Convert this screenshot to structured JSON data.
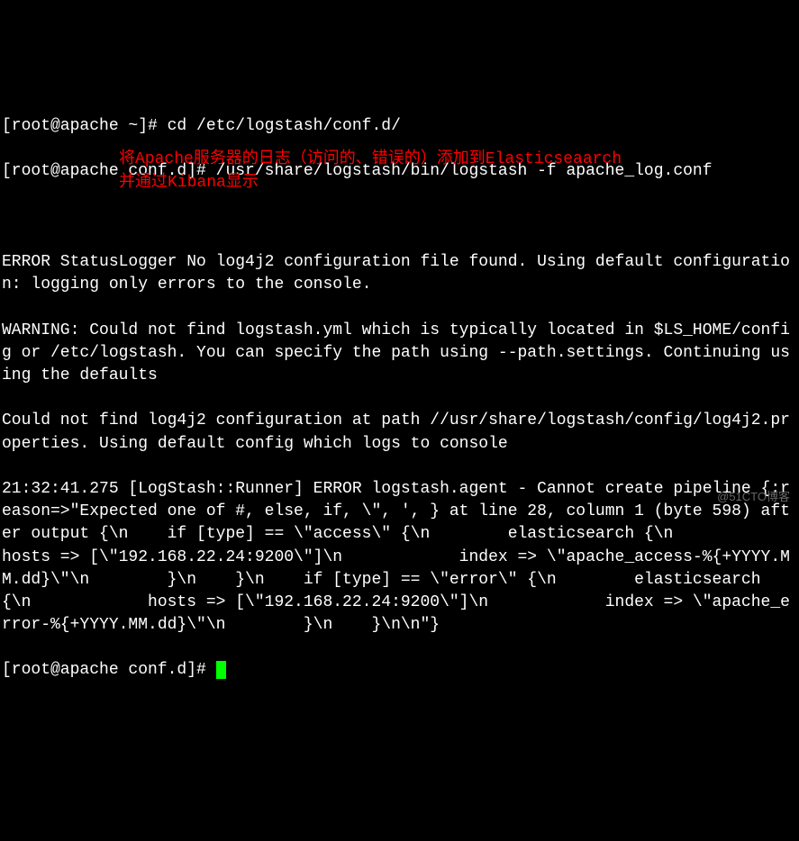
{
  "terminal": {
    "line1": "[root@apache ~]# cd /etc/logstash/conf.d/",
    "line2": "[root@apache conf.d]# /usr/share/logstash/bin/logstash -f apache_log.conf",
    "line3": "ERROR StatusLogger No log4j2 configuration file found. Using default configuration: logging only errors to the console.",
    "line4": "WARNING: Could not find logstash.yml which is typically located in $LS_HOME/config or /etc/logstash. You can specify the path using --path.settings. Continuing using the defaults",
    "line5": "Could not find log4j2 configuration at path //usr/share/logstash/config/log4j2.properties. Using default config which logs to console",
    "line6": "21:32:41.275 [LogStash::Runner] ERROR logstash.agent - Cannot create pipeline {:reason=>\"Expected one of #, else, if, \\\", ', } at line 28, column 1 (byte 598) after output {\\n    if [type] == \\\"access\\\" {\\n        elasticsearch {\\n            hosts => [\\\"192.168.22.24:9200\\\"]\\n            index => \\\"apache_access-%{+YYYY.MM.dd}\\\"\\n        }\\n    }\\n    if [type] == \\\"error\\\" {\\n        elasticsearch {\\n            hosts => [\\\"192.168.22.24:9200\\\"]\\n            index => \\\"apache_error-%{+YYYY.MM.dd}\\\"\\n        }\\n    }\\n\\n\"}",
    "prompt": "[root@apache conf.d]# "
  },
  "annotation": {
    "line1": "将Apache服务器的日志（访问的、错误的）添加到Elasticseaarch",
    "line2": "并通过Kibana显示"
  },
  "watermark": "@51CTO博客"
}
